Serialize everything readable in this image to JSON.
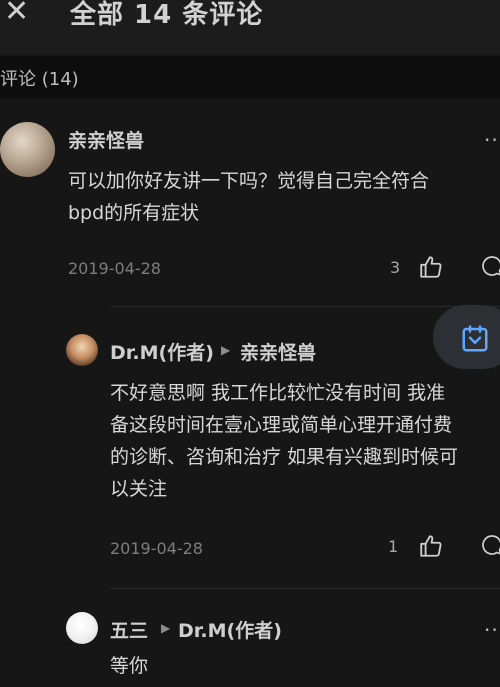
{
  "header": {
    "close": "✕",
    "title": "全部 14 条评论"
  },
  "comments_section": {
    "count_label": "评论 (14)"
  },
  "comments": [
    {
      "author": "亲亲怪兽",
      "text": "可以加你好友讲一下吗？觉得自己完全符合\nbpd的所有症状",
      "date": "2019-04-28",
      "likes": "3"
    },
    {
      "author": "Dr.M(作者)",
      "reply_arrow": "▶",
      "reply_to": "亲亲怪兽",
      "text": "不好意思啊 我工作比较忙没有时间 我准\n备这段时间在壹心理或简单心理开通付费\n的诊断、咨询和治疗 如果有兴趣到时候可\n以关注",
      "date": "2019-04-28",
      "likes": "1"
    },
    {
      "author": "五三",
      "reply_arrow": "▶",
      "reply_to": "Dr.M(作者)",
      "text": "等你"
    }
  ],
  "more_label": "···"
}
